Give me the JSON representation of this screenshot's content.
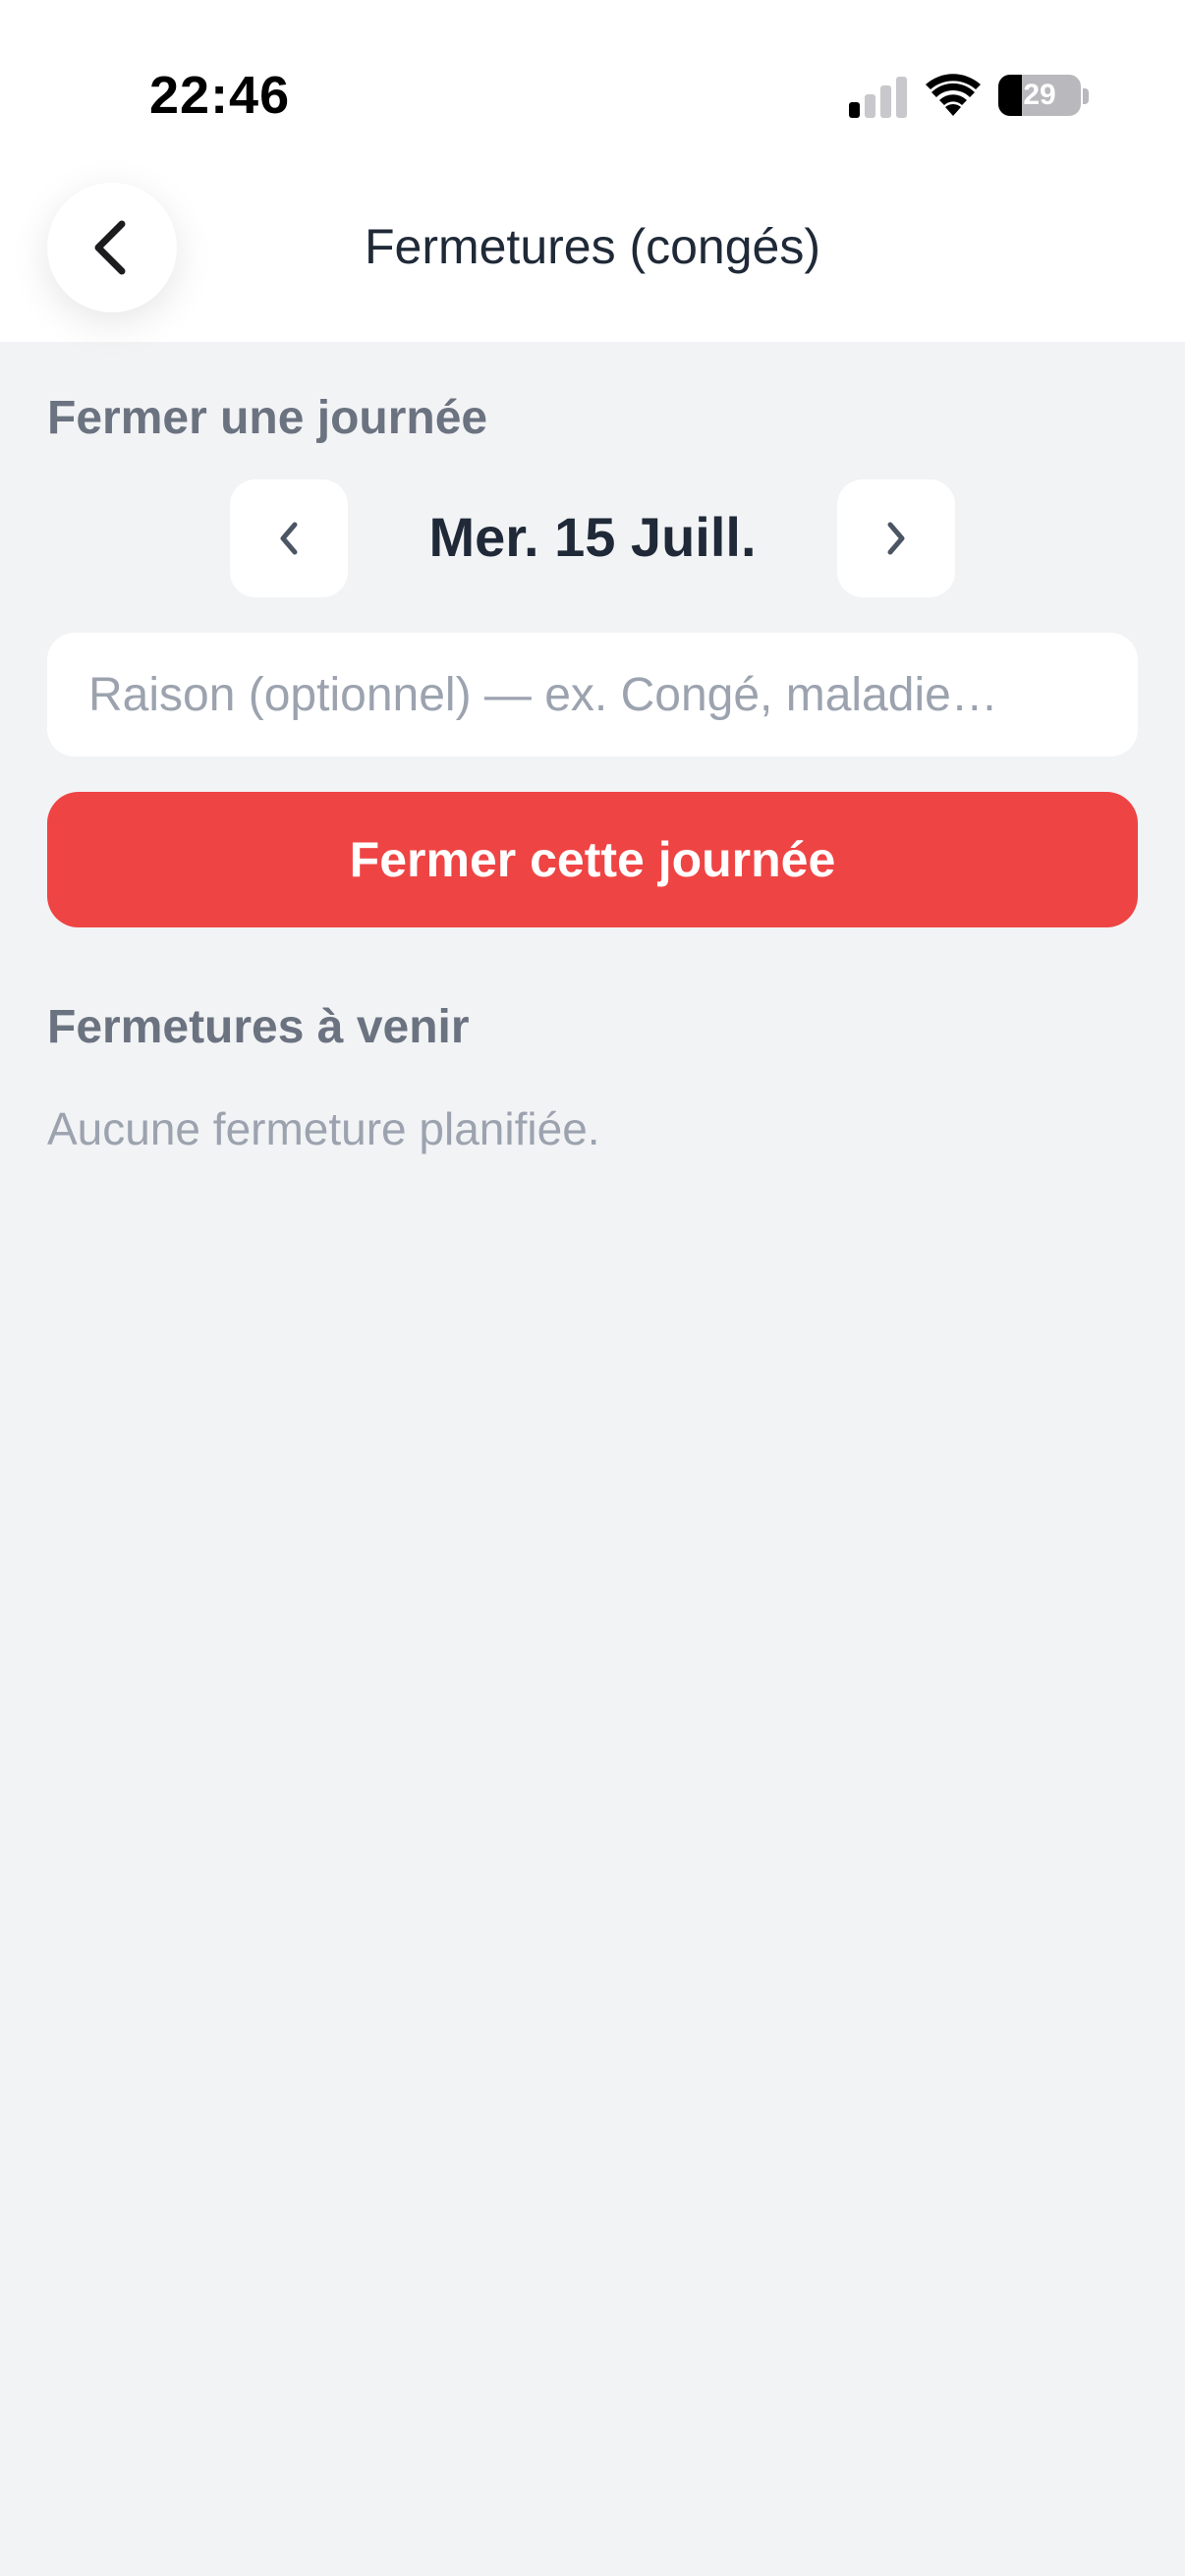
{
  "status_bar": {
    "time": "22:46",
    "battery_level": "29",
    "signal_bars_active": 1,
    "signal_bars_total": 4,
    "icons": [
      "cellular-signal-icon",
      "wifi-icon",
      "battery-icon"
    ]
  },
  "nav": {
    "title": "Fermetures (congés)",
    "back_icon": "chevron-left-icon"
  },
  "close_day": {
    "section_title": "Fermer une journée",
    "date_label": "Mer. 15 Juill.",
    "prev_icon": "‹",
    "next_icon": "›",
    "reason_placeholder": "Raison (optionnel) — ex. Congé, maladie…",
    "reason_value": "",
    "submit_label": "Fermer cette journée"
  },
  "upcoming": {
    "section_title": "Fermetures à venir",
    "empty_text": "Aucune fermeture planifiée."
  },
  "colors": {
    "accent_red": "#ef4444",
    "background": "#f2f3f5",
    "text_dark": "#1f2937",
    "text_muted": "#6b7280",
    "text_placeholder": "#9ca3af"
  }
}
